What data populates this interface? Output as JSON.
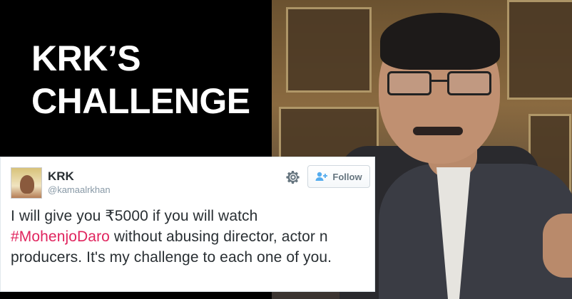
{
  "headline": {
    "line1": "KRK’S",
    "line2": "CHALLENGE"
  },
  "tweet": {
    "display_name": "KRK",
    "handle": "@kamaalrkhan",
    "follow_label": "Follow",
    "text_part1": "I will give you ₹5000 if you will watch",
    "hashtag": "#MohenjoDaro",
    "text_part2": " without abusing director, actor n producers. It's my challenge to each one of you."
  },
  "icons": {
    "settings": "gear-icon",
    "follow": "follow-user-icon"
  },
  "colors": {
    "hashtag": "#e0245e",
    "text": "#292f33",
    "meta": "#8899a6",
    "background": "#000000"
  }
}
